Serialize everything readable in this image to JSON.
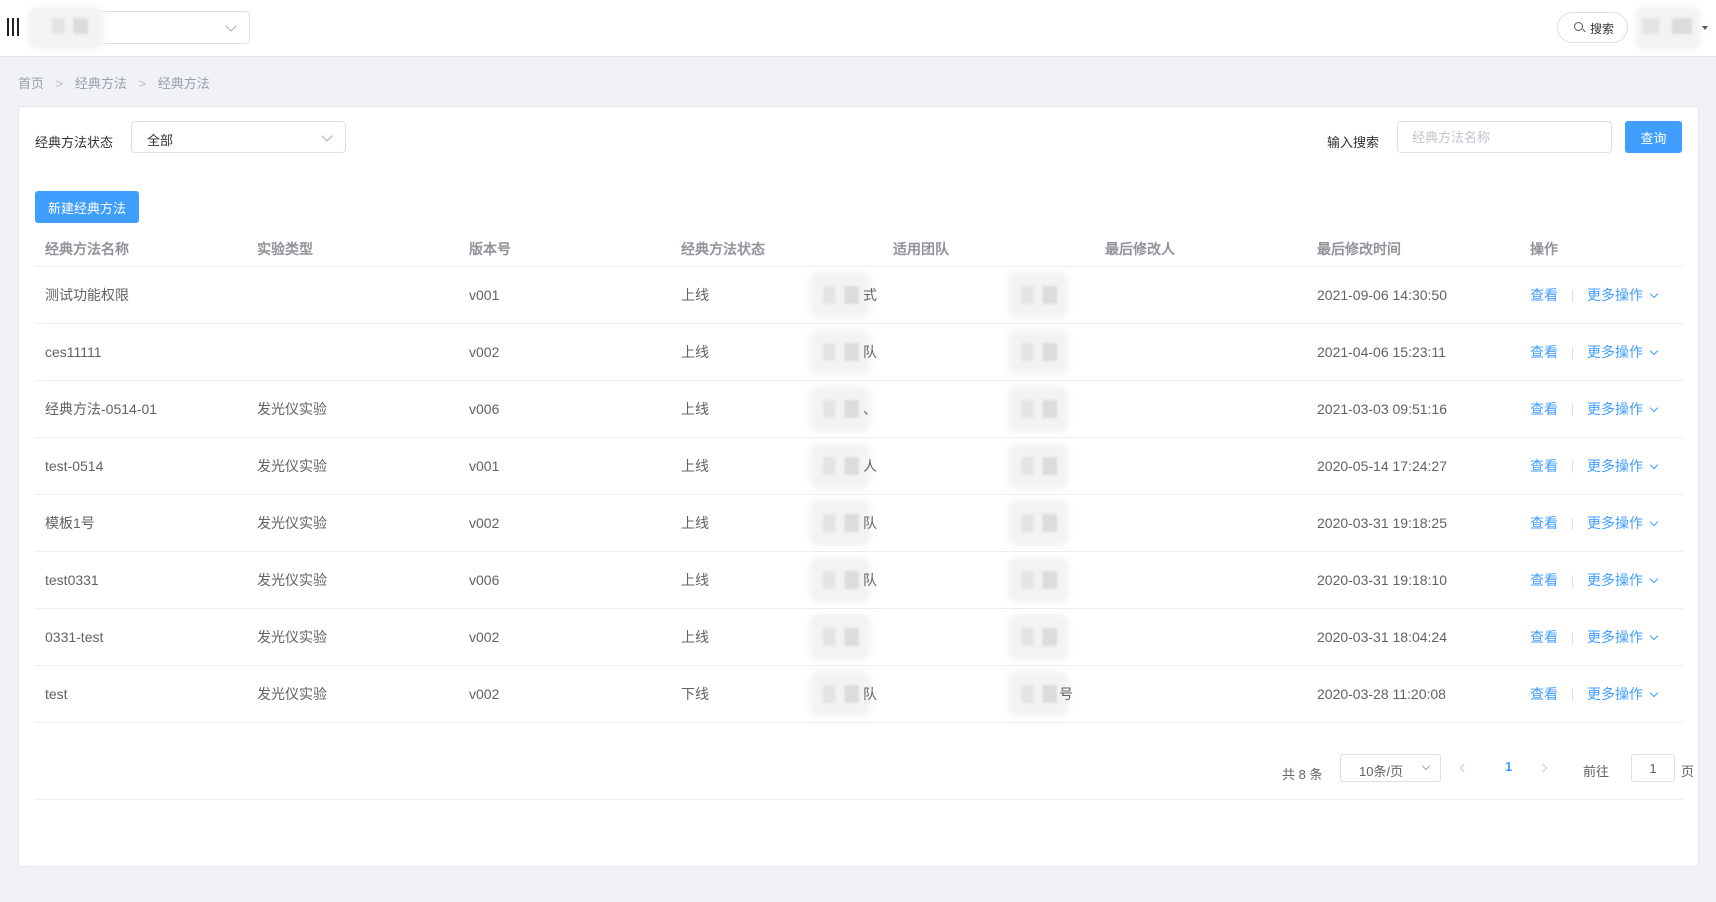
{
  "topbar": {
    "search_label": "搜索"
  },
  "breadcrumb": [
    "首页",
    "经典方法",
    "经典方法"
  ],
  "breadcrumb_sep": ">",
  "filters": {
    "status_label": "经典方法状态",
    "status_value": "全部",
    "search_label": "输入搜索",
    "search_placeholder": "经典方法名称",
    "query_button": "查询"
  },
  "new_button": "新建经典方法",
  "table": {
    "headers": [
      "经典方法名称",
      "实验类型",
      "版本号",
      "经典方法状态",
      "适用团队",
      "最后修改人",
      "最后修改时间",
      "操作"
    ],
    "rows": [
      {
        "name": "测试功能权限",
        "type": "",
        "version": "v001",
        "status": "上线",
        "team": "式",
        "modifier": "",
        "time": "2021-09-06 14:30:50"
      },
      {
        "name": "ces11111",
        "type": "",
        "version": "v002",
        "status": "上线",
        "team": "队",
        "modifier": "",
        "time": "2021-04-06 15:23:11"
      },
      {
        "name": "经典方法-0514-01",
        "type": "发光仪实验",
        "version": "v006",
        "status": "上线",
        "team": "、",
        "modifier": "",
        "time": "2021-03-03 09:51:16"
      },
      {
        "name": "test-0514",
        "type": "发光仪实验",
        "version": "v001",
        "status": "上线",
        "team": "人",
        "modifier": "",
        "time": "2020-05-14 17:24:27"
      },
      {
        "name": "模板1号",
        "type": "发光仪实验",
        "version": "v002",
        "status": "上线",
        "team": "队",
        "modifier": "",
        "time": "2020-03-31 19:18:25"
      },
      {
        "name": "test0331",
        "type": "发光仪实验",
        "version": "v006",
        "status": "上线",
        "team": "队",
        "modifier": "",
        "time": "2020-03-31 19:18:10"
      },
      {
        "name": "0331-test",
        "type": "发光仪实验",
        "version": "v002",
        "status": "上线",
        "team": "",
        "modifier": "",
        "time": "2020-03-31 18:04:24"
      },
      {
        "name": "test",
        "type": "发光仪实验",
        "version": "v002",
        "status": "下线",
        "team": "队",
        "modifier": "号",
        "time": "2020-03-28 11:20:08"
      }
    ],
    "actions": {
      "view": "查看",
      "more": "更多操作"
    }
  },
  "pagination": {
    "total": "共 8 条",
    "page_size": "10条/页",
    "current_page": "1",
    "goto_label": "前往",
    "goto_value": "1",
    "page_suffix": "页"
  }
}
